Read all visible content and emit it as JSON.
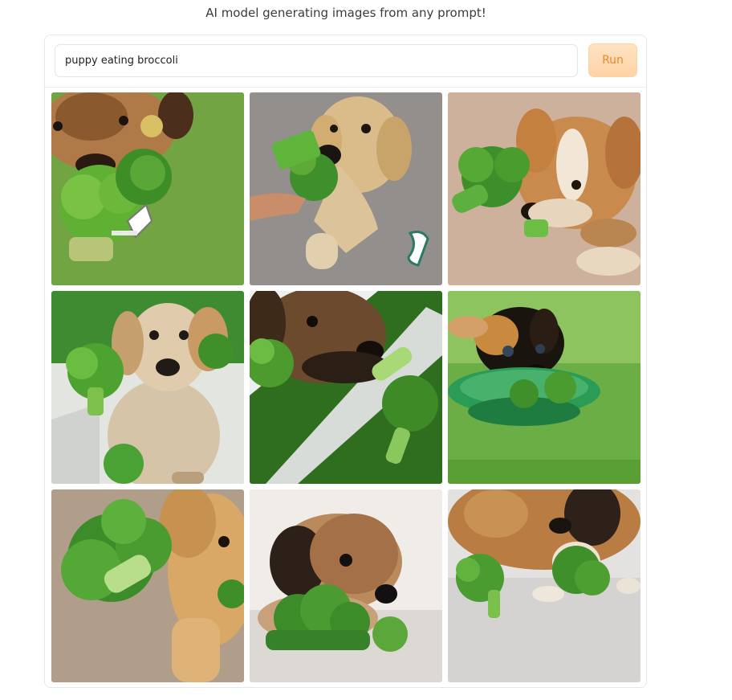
{
  "header": {
    "subtitle": "AI model generating images from any prompt!"
  },
  "prompt": {
    "value": "puppy eating broccoli"
  },
  "run_button": {
    "label": "Run"
  },
  "gallery": {
    "images": [
      {
        "subject": "puppy-broccoli-grass-fork"
      },
      {
        "subject": "puppy-broccoli-carpet-hand"
      },
      {
        "subject": "puppy-broccoli-carpet-tan"
      },
      {
        "subject": "puppy-broccoli-white-floor"
      },
      {
        "subject": "puppy-broccoli-closeup"
      },
      {
        "subject": "puppy-broccoli-green-bowl"
      },
      {
        "subject": "puppy-broccoli-large-floret"
      },
      {
        "subject": "puppy-broccoli-floor-white"
      },
      {
        "subject": "puppy-broccoli-sniffing"
      }
    ]
  },
  "colors": {
    "run_text": "#ea8a2c",
    "run_bg": "#fdd3a6",
    "broccoli": "#3f8f2c",
    "grass": "#5a9b3a"
  }
}
